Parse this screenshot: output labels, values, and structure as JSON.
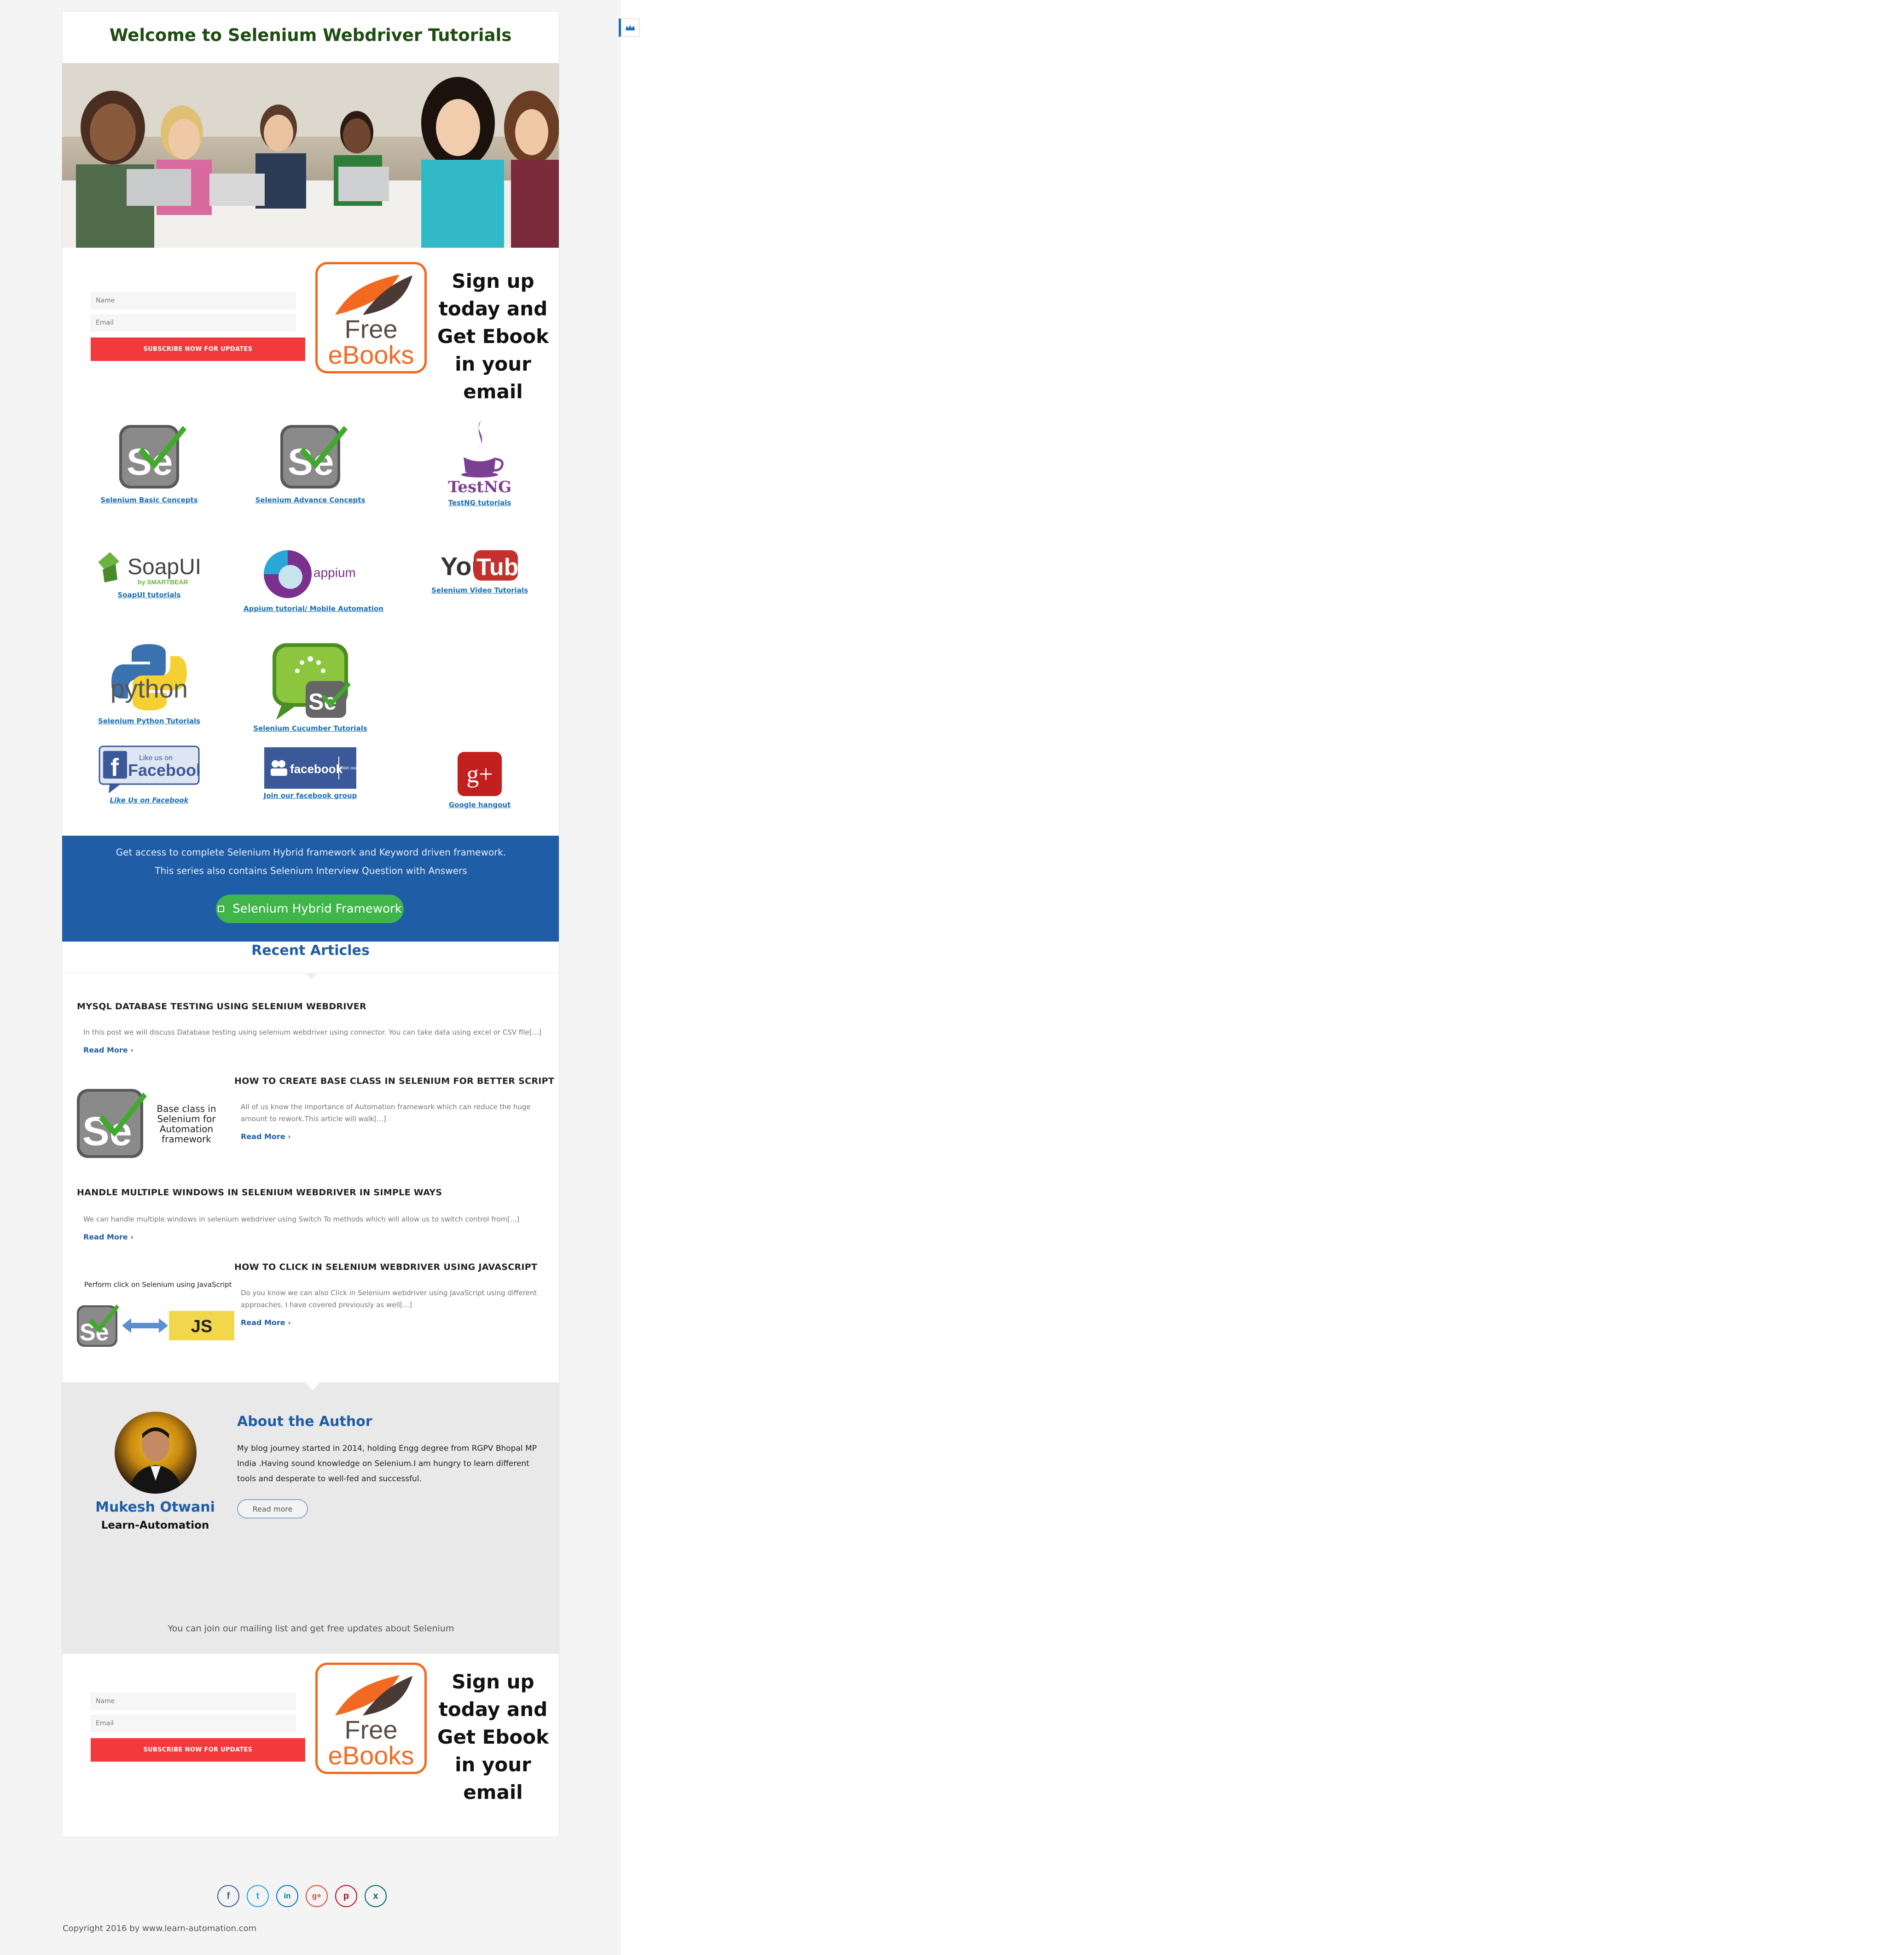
{
  "page": {
    "title": "Welcome to Selenium Webdriver Tutorials"
  },
  "subscribe": {
    "name_placeholder": "Name",
    "email_placeholder": "Email",
    "button_label": "SUBSCRIBE NOW FOR UPDATES",
    "logo_free": "Free",
    "logo_ebooks": "eBooks",
    "promo_text": "Sign up today and Get Ebook in your email"
  },
  "tiles": [
    {
      "label": "Selenium Basic Concepts",
      "icon": "selenium-icon"
    },
    {
      "label": "Selenium Advance Concepts",
      "icon": "selenium-icon"
    },
    {
      "label": "TestNG tutorials",
      "icon": "testng-icon",
      "logo_text": "TestNG"
    },
    {
      "label": "SoapUI tutorials",
      "icon": "soapui-icon",
      "logo_text": "SoapUI",
      "logo_sub": "by SMARTBEAR"
    },
    {
      "label": "Appium tutorial/ Mobile Automation",
      "icon": "appium-icon",
      "logo_text": "appium"
    },
    {
      "label": "Selenium Video Tutorials",
      "icon": "youtube-icon",
      "logo_you": "You",
      "logo_tube": "Tube"
    },
    {
      "label": "Selenium Python Tutorials",
      "icon": "python-icon",
      "logo_text": "python"
    },
    {
      "label": "Selenium Cucumber Tutorials",
      "icon": "cucumber-selenium-icon"
    },
    {
      "label": "Like Us on Facebook",
      "icon": "facebook-like-icon",
      "logo_small": "Like us on",
      "logo_text": "Facebook"
    },
    {
      "label": "Join our facebook group",
      "icon": "facebook-group-icon",
      "logo_text": "facebook",
      "logo_side": "Join our group"
    },
    {
      "label": "Google hangout",
      "icon": "google-plus-icon",
      "logo_text": "g+"
    }
  ],
  "banner": {
    "line1": "Get access to complete Selenium Hybrid framework and Keyword driven framework.",
    "line2": "This series also contains Selenium Interview Question with Answers",
    "button_label": "Selenium Hybrid Framework",
    "color": "#1f5da6",
    "button_color": "#3fb54a"
  },
  "recent": {
    "heading": "Recent Articles",
    "read_more": "Read More ›",
    "articles": [
      {
        "title": "MYSQL DATABASE TESTING USING SELENIUM WEBDRIVER",
        "excerpt": "In this post we will discuss Database testing using selenium webdriver using connector. You can take data using excel or CSV file[...]"
      },
      {
        "title": "HOW TO CREATE BASE CLASS IN SELENIUM FOR BETTER SCRIPT",
        "excerpt": "All of us know the importance of Automation framework which can reduce the huge amount to rework.This article will walk[...]",
        "thumb_text": "Base class in Selenium for Automation framework"
      },
      {
        "title": "HANDLE MULTIPLE WINDOWS IN SELENIUM WEBDRIVER IN SIMPLE WAYS",
        "excerpt": "We can handle multiple windows in selenium webdriver  using Switch To methods which will allow us to switch control from[...]"
      },
      {
        "title": "HOW TO CLICK IN SELENIUM WEBDRIVER USING JAVASCRIPT",
        "excerpt": "Do you know we can also Click in Selenium webdriver using JavaScript using different approaches. I have covered previously as well[...]",
        "thumb_text": "Perform click on Selenium using JavaScript",
        "thumb_js": "JS"
      }
    ]
  },
  "author": {
    "heading": "About the Author",
    "name": "Mukesh Otwani",
    "site": "Learn-Automation",
    "bio": "My blog journey started in 2014, holding Engg degree from RGPV Bhopal MP India .Having sound knowledge on Selenium.I am hungry to learn different tools and desperate to well-fed and successful.",
    "read_more": "Read more",
    "mailing_text": "You can join our mailing list and get free updates about Selenium"
  },
  "footer": {
    "social": [
      {
        "icon": "facebook-icon",
        "glyph": "f",
        "color": "#3b5998"
      },
      {
        "icon": "twitter-icon",
        "glyph": "t",
        "color": "#1da1f2"
      },
      {
        "icon": "linkedin-icon",
        "glyph": "in",
        "color": "#0077b5"
      },
      {
        "icon": "google-plus-icon",
        "glyph": "g+",
        "color": "#dd4b39"
      },
      {
        "icon": "pinterest-icon",
        "glyph": "p",
        "color": "#bd081c"
      },
      {
        "icon": "xing-icon",
        "glyph": "x",
        "color": "#026466"
      }
    ],
    "copyright": "Copyright  2016 by www.learn-automation.com"
  }
}
